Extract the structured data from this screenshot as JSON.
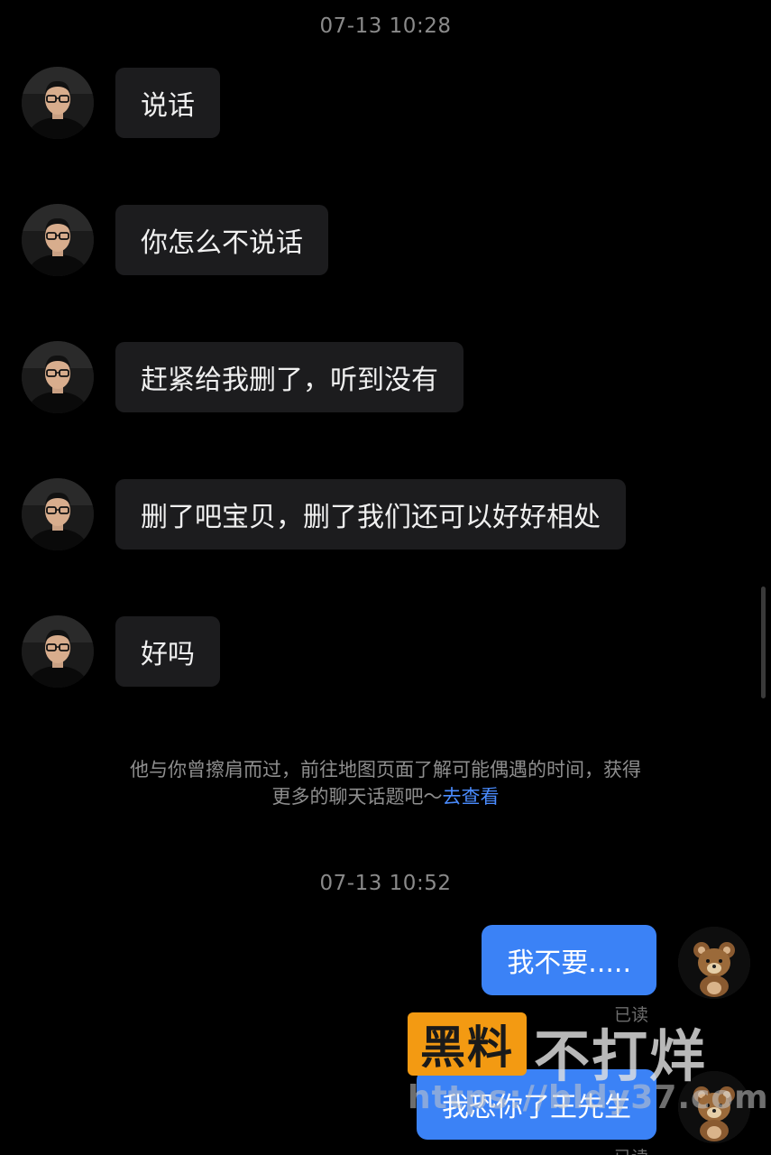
{
  "conversation": {
    "timestamp_1": "07-13 10:28",
    "incoming": [
      {
        "text": "说话"
      },
      {
        "text": "你怎么不说话"
      },
      {
        "text": "赶紧给我删了，听到没有"
      },
      {
        "text": "删了吧宝贝，删了我们还可以好好相处"
      },
      {
        "text": "好吗"
      }
    ],
    "system_note": {
      "line1": "他与你曾擦肩而过，前往地图页面了解可能偶遇的时间，获得",
      "line2": "更多的聊天话题吧～",
      "link": "去查看"
    },
    "timestamp_2": "07-13 10:52",
    "outgoing": [
      {
        "text": "我不要.....",
        "status": "已读"
      },
      {
        "text": "我恐你了王先生",
        "status": "已读"
      }
    ]
  },
  "watermark": {
    "badge": "黑料",
    "text": "不打烊",
    "url": "https://bldy37.com"
  },
  "icons": {
    "incoming_avatar": "man-with-glasses-avatar",
    "outgoing_avatar": "teddy-bear-avatar"
  },
  "colors": {
    "background": "#000000",
    "incoming_bubble": "#1c1c1e",
    "outgoing_bubble": "#3b82f6",
    "link": "#4a8cff",
    "watermark_badge": "#f39a12"
  }
}
